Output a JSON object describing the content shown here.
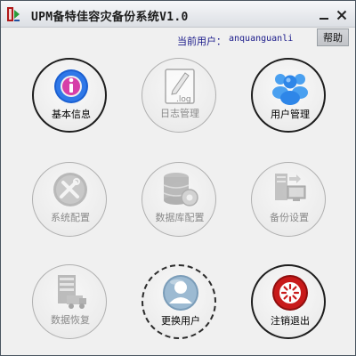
{
  "window": {
    "title": "UPM备特佳容灾备份系统V1.0",
    "minimize_glyph": "minimize-icon",
    "close_glyph": "close-icon"
  },
  "header": {
    "current_user_label": "当前用户：",
    "current_user_name": "anquanguanli",
    "help_label": "帮助"
  },
  "tiles": [
    {
      "label": "基本信息",
      "icon": "info-icon",
      "enabled": true
    },
    {
      "label": "日志管理",
      "icon": "log-file-icon",
      "enabled": false
    },
    {
      "label": "用户管理",
      "icon": "users-icon",
      "enabled": true
    },
    {
      "label": "系统配置",
      "icon": "tools-icon",
      "enabled": false
    },
    {
      "label": "数据库配置",
      "icon": "database-gear-icon",
      "enabled": false
    },
    {
      "label": "备份设置",
      "icon": "backup-computer-icon",
      "enabled": false
    },
    {
      "label": "数据恢复",
      "icon": "server-truck-icon",
      "enabled": false
    },
    {
      "label": "更换用户",
      "icon": "user-switch-icon",
      "enabled": true
    },
    {
      "label": "注销退出",
      "icon": "logout-icon",
      "enabled": true
    }
  ],
  "colors": {
    "user_text": "#1a1a8a",
    "info_blue": "#1a5fd1",
    "info_pink": "#d63fa8",
    "logout_red": "#c81a1a"
  }
}
